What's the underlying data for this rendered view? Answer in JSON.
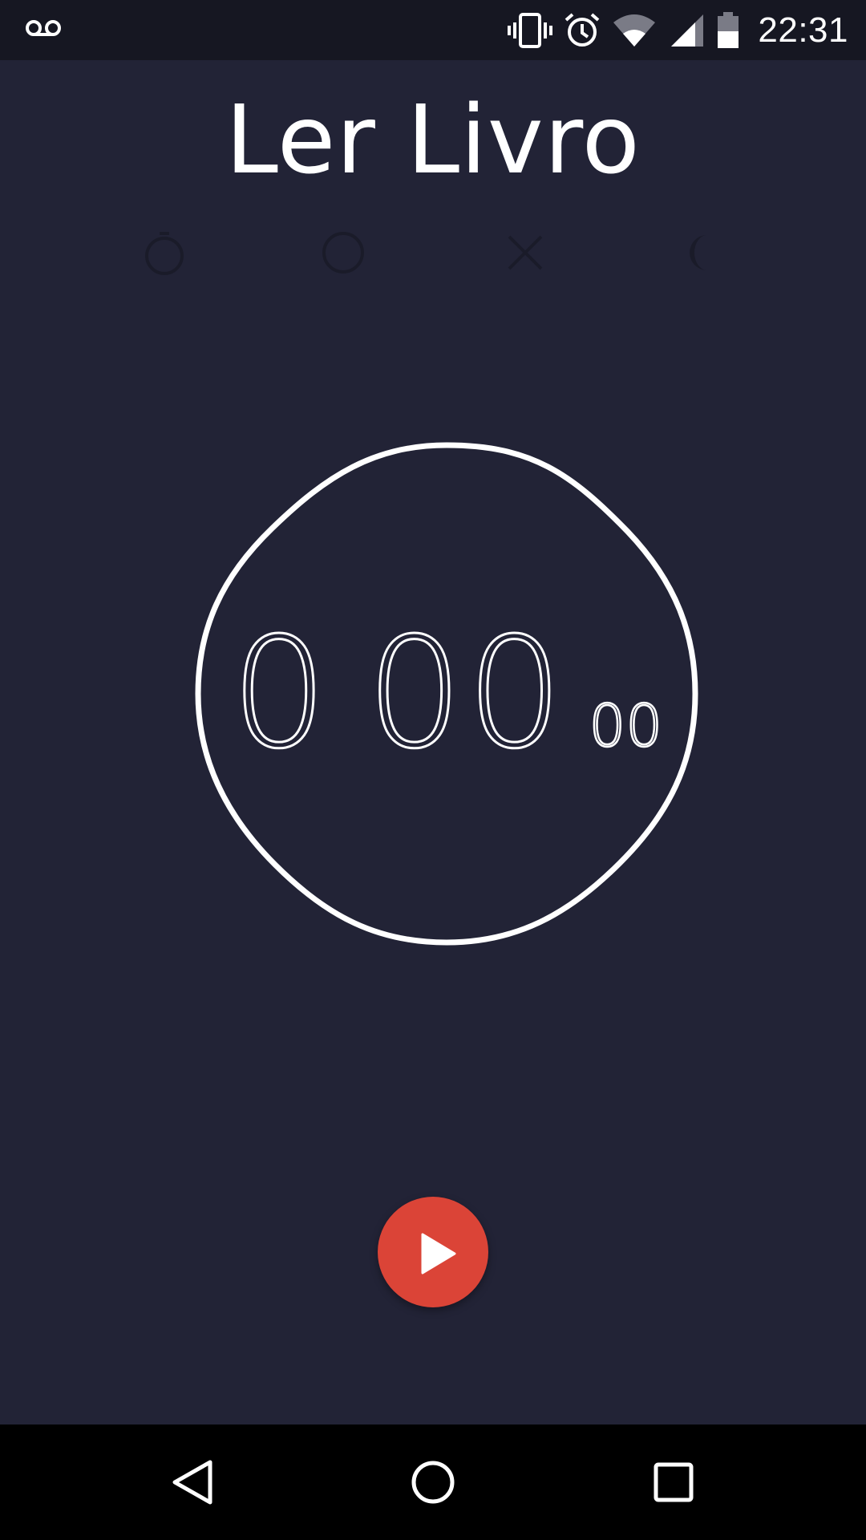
{
  "status_bar": {
    "time": "22:31",
    "icons": [
      "voicemail-icon",
      "vibrate-icon",
      "alarm-icon",
      "wifi-icon",
      "cell-signal-icon",
      "battery-icon"
    ],
    "background": "#161722"
  },
  "header": {
    "title": "Ler Livro"
  },
  "mode_icons": [
    "stopwatch-icon",
    "circle-icon",
    "shuffle-icon",
    "moon-icon"
  ],
  "timer": {
    "hours": "0",
    "minutes": "00",
    "hundredths": "00",
    "ring_color": "#ffffff"
  },
  "controls": {
    "play_icon": "play-icon",
    "accent": "#db4437"
  },
  "nav_bar": {
    "icons": [
      "back-icon",
      "home-icon",
      "recents-icon"
    ]
  },
  "theme": {
    "background": "#222336"
  }
}
